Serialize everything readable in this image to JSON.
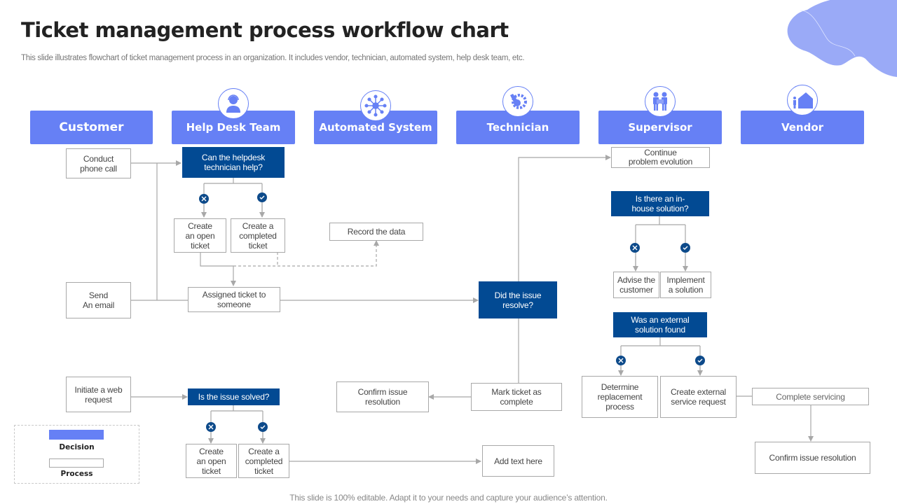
{
  "header": {
    "title": "Ticket management process workflow chart",
    "subtitle": "This slide illustrates flowchart of ticket management process in an organization. It includes vendor, technician, automated system, help desk team, etc."
  },
  "lanes": [
    {
      "label": "Customer",
      "icon": null
    },
    {
      "label": "Help Desk Team",
      "icon": "headset-agent-icon"
    },
    {
      "label": "Automated System",
      "icon": "network-hub-icon"
    },
    {
      "label": "Technician",
      "icon": "wrench-gear-icon"
    },
    {
      "label": "Supervisor",
      "icon": "engineers-icon"
    },
    {
      "label": "Vendor",
      "icon": "warehouse-icon"
    }
  ],
  "nodes": {
    "conduct_phone_call": "Conduct\nphone call",
    "send_email": "Send\nAn email",
    "initiate_web_request": "Initiate a web\nrequest",
    "can_helpdesk_help": "Can the helpdesk\ntechnician help?",
    "create_open_ticket_1": "Create\nan open\nticket",
    "create_completed_ticket_1": "Create a\ncompleted\nticket",
    "record_data": "Record the data",
    "assigned_ticket": "Assigned ticket to\nsomeone",
    "is_issue_solved": "Is the issue solved?",
    "create_open_ticket_2": "Create\nan open\nticket",
    "create_completed_ticket_2": "Create a\ncompleted\nticket",
    "did_issue_resolve": "Did the issue\nresolve?",
    "mark_ticket_complete": "Mark ticket as\ncomplete",
    "confirm_issue_resolution_1": "Confirm issue\nresolution",
    "add_text_here": "Add text here",
    "continue_problem_evolution": "Continue\nproblem evolution",
    "in_house_solution": "Is there an in-\nhouse solution?",
    "advise_customer": "Advise the\ncustomer",
    "implement_solution": "Implement\na solution",
    "external_solution_found": "Was an external\nsolution found",
    "determine_replacement": "Determine\nreplacement\nprocess",
    "create_external_request": "Create external\nservice request",
    "complete_servicing": "Complete servicing",
    "confirm_issue_resolution_2": "Confirm issue resolution"
  },
  "legend": {
    "decision_label": "Decision",
    "process_label": "Process"
  },
  "colors": {
    "lane": "#6680f5",
    "decision": "#024a93",
    "badge": "#0d4a8a",
    "connector": "#a8a8a8",
    "blob": "#9aaaf7"
  },
  "footer": "This slide is 100% editable. Adapt it to your needs and capture your audience’s attention."
}
